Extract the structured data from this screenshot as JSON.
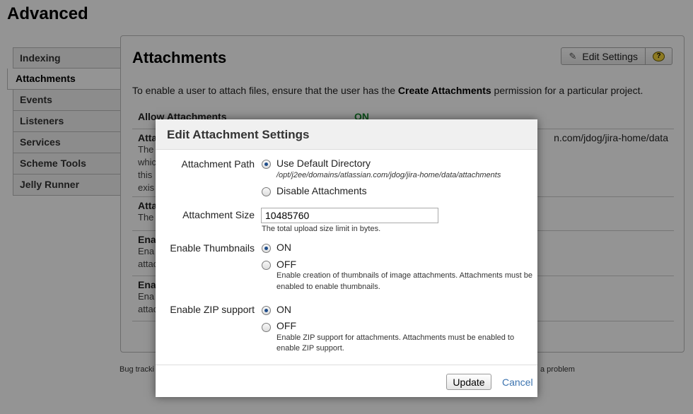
{
  "page": {
    "title": "Advanced"
  },
  "sidebar": {
    "items": [
      {
        "label": "Indexing"
      },
      {
        "label": "Attachments"
      },
      {
        "label": "Events"
      },
      {
        "label": "Listeners"
      },
      {
        "label": "Services"
      },
      {
        "label": "Scheme Tools"
      },
      {
        "label": "Jelly Runner"
      }
    ]
  },
  "panel": {
    "title": "Attachments",
    "edit_settings_label": "Edit Settings",
    "help_icon": "?",
    "intro_prefix": "To enable a user to attach files, ensure that the user has the ",
    "intro_bold": "Create Attachments",
    "intro_suffix": " permission for a particular project.",
    "rows": [
      {
        "label": "Allow Attachments",
        "value": "ON"
      },
      {
        "label": "Atta",
        "desc_lines": [
          "The",
          "whic",
          "this",
          "exis"
        ],
        "value": "n.com/jdog/jira-home/data"
      },
      {
        "label": "Atta",
        "desc_lines": [
          "The"
        ]
      },
      {
        "label": "Ena",
        "desc_lines": [
          "Ena",
          "attac"
        ]
      },
      {
        "label": "Ena",
        "desc_lines": [
          "Ena",
          "attac"
        ]
      }
    ]
  },
  "footer": {
    "left": "Bug tracki",
    "right": "a problem"
  },
  "dialog": {
    "title": "Edit Attachment Settings",
    "attachment_path": {
      "label": "Attachment Path",
      "option_default": "Use Default Directory",
      "default_path": "/opt/j2ee/domains/atlassian.com/jdog/jira-home/data/attachments",
      "option_disable": "Disable Attachments"
    },
    "attachment_size": {
      "label": "Attachment Size",
      "value": "10485760",
      "hint": "The total upload size limit in bytes."
    },
    "thumbnails": {
      "label": "Enable Thumbnails",
      "on": "ON",
      "off": "OFF",
      "hint_line1": "Enable creation of thumbnails of image attachments. Attachments must be",
      "hint_line2": "enabled to enable thumbnails."
    },
    "zip": {
      "label": "Enable ZIP support",
      "on": "ON",
      "off": "OFF",
      "hint_line1": "Enable ZIP support for attachments. Attachments must be enabled to",
      "hint_line2": "enable ZIP support."
    },
    "update_label": "Update",
    "cancel_label": "Cancel"
  }
}
